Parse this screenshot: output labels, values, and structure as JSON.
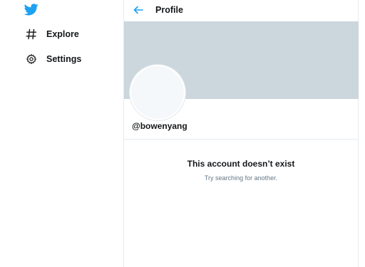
{
  "sidebar": {
    "logo_icon": "twitter-bird-icon",
    "items": [
      {
        "label": "Explore",
        "icon": "hashtag-icon"
      },
      {
        "label": "Settings",
        "icon": "gear-icon"
      }
    ]
  },
  "header": {
    "back_icon": "arrow-left-icon",
    "title": "Profile"
  },
  "profile": {
    "handle": "@bowenyang"
  },
  "empty_state": {
    "title": "This account doesn’t exist",
    "subtitle": "Try searching for another."
  },
  "colors": {
    "brand": "#1da1f2",
    "banner": "#ccd6dd",
    "text": "#14171a",
    "muted": "#657786",
    "border": "#e6ecf0"
  }
}
